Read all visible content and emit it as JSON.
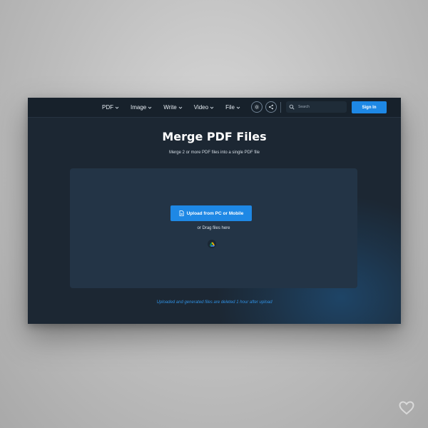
{
  "nav": {
    "items": [
      {
        "label": "PDF"
      },
      {
        "label": "Image"
      },
      {
        "label": "Write"
      },
      {
        "label": "Video"
      },
      {
        "label": "File"
      }
    ],
    "search_placeholder": "Search",
    "signin_label": "Sign In"
  },
  "hero": {
    "title": "Merge PDF Files",
    "subtitle": "Merge 2 or more PDF files into a single PDF file"
  },
  "dropzone": {
    "upload_label": "Upload from PC or Mobile",
    "drag_label": "or Drag files here"
  },
  "notice": "Uploaded and generated files are deleted 1 hour after upload",
  "icons": {
    "theme": "sun-icon",
    "share": "share-icon",
    "search": "search-icon",
    "upload": "file-icon",
    "drive": "google-drive-icon",
    "corner": "heart-icon"
  },
  "colors": {
    "accent": "#1e88e5",
    "notice": "#2f8fe0",
    "panel": "#1c2733",
    "dropzone": "#233446"
  }
}
